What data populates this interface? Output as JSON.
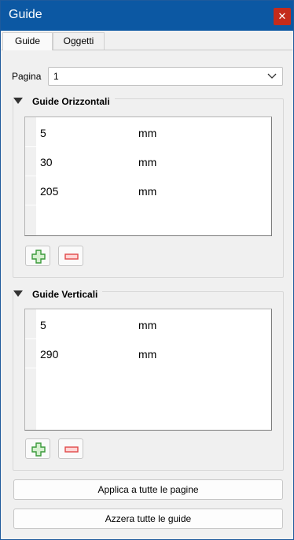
{
  "window": {
    "title": "Guide",
    "close_glyph": "✕"
  },
  "tabs": [
    {
      "label": "Guide",
      "active": true
    },
    {
      "label": "Oggetti",
      "active": false
    }
  ],
  "page": {
    "label": "Pagina",
    "value": "1"
  },
  "horizontal": {
    "title": "Guide Orizzontali",
    "rows": [
      {
        "value": "5",
        "unit": "mm"
      },
      {
        "value": "30",
        "unit": "mm"
      },
      {
        "value": "205",
        "unit": "mm"
      }
    ]
  },
  "vertical": {
    "title": "Guide Verticali",
    "rows": [
      {
        "value": "5",
        "unit": "mm"
      },
      {
        "value": "290",
        "unit": "mm"
      }
    ]
  },
  "buttons": {
    "apply_all": "Applica a tutte le pagine",
    "reset_all": "Azzera tutte le guide"
  },
  "colors": {
    "titlebar": "#0c58a3",
    "close": "#c42b1c",
    "add_icon": "#3a9a3a",
    "remove_icon": "#e04848"
  }
}
